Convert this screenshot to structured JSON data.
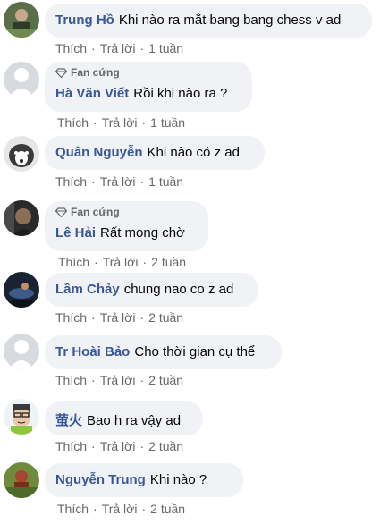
{
  "comments": [
    {
      "author": "Trung Hồ",
      "text": "Khi nào ra mắt bang bang chess v ad",
      "badge": "",
      "like": "Thích",
      "reply": "Trả lời",
      "time": "1 tuần"
    },
    {
      "author": "Hà Văn Viết",
      "text": "Rồi khi nào ra ?",
      "badge": "Fan cứng",
      "like": "Thích",
      "reply": "Trả lời",
      "time": "1 tuần"
    },
    {
      "author": "Quân Nguyễn",
      "text": "Khi nào có z ad",
      "badge": "",
      "like": "Thích",
      "reply": "Trả lời",
      "time": "1 tuần"
    },
    {
      "author": "Lê Hải",
      "text": "Rất mong chờ",
      "badge": "Fan cứng",
      "like": "Thích",
      "reply": "Trả lời",
      "time": "2 tuần"
    },
    {
      "author": "Lầm Chảy",
      "text": "chung nao co z ad",
      "badge": "",
      "like": "Thích",
      "reply": "Trả lời",
      "time": "2 tuần"
    },
    {
      "author": "Tr Hoài Bảo",
      "text": "Cho thời gian cụ thể",
      "badge": "",
      "like": "Thích",
      "reply": "Trả lời",
      "time": "2 tuần"
    },
    {
      "author": "萤火",
      "text": "Bao h ra vậy ad",
      "badge": "",
      "like": "Thích",
      "reply": "Trả lời",
      "time": "2 tuần"
    },
    {
      "author": "Nguyễn Trung",
      "text": "Khi nào ?",
      "badge": "",
      "like": "Thích",
      "reply": "Trả lời",
      "time": "2 tuần"
    }
  ],
  "colors": {
    "author": "#385898",
    "bubble": "#f0f2f5",
    "meta": "#65676b"
  },
  "separator": "·"
}
